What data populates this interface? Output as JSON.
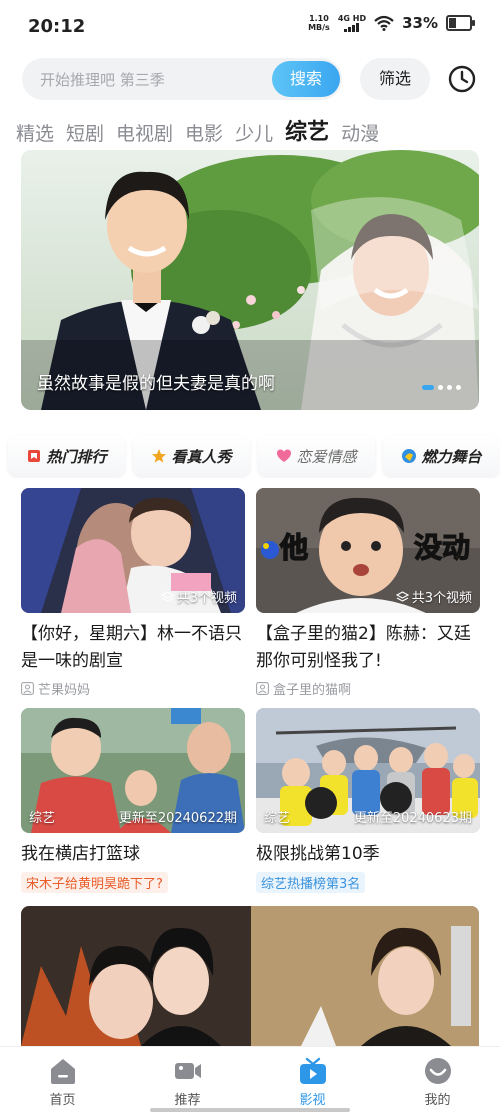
{
  "status_bar": {
    "time": "20:12",
    "speed_value": "1.10",
    "speed_unit": "MB/s",
    "network": "4G HD",
    "battery": "33%",
    "battery_level": 0.33
  },
  "search": {
    "placeholder": "开始推理吧 第三季",
    "button_label": "搜索",
    "filter_label": "筛选",
    "accent": "#3aa6f0"
  },
  "category_tabs": [
    "精选",
    "短剧",
    "电视剧",
    "电影",
    "少儿",
    "综艺",
    "动漫"
  ],
  "active_category": "综艺",
  "hero": {
    "caption": "虽然故事是假的但夫妻是真的啊",
    "slide_count": 4,
    "active_slide": 1
  },
  "chips": [
    {
      "label": "热门排行",
      "icon": "hot-rank-icon",
      "color": "#e8473a"
    },
    {
      "label": "看真人秀",
      "icon": "star-icon",
      "color": "#f2a51e"
    },
    {
      "label": "恋爱情感",
      "icon": "heart-icon",
      "color": "#f06a9a"
    },
    {
      "label": "燃力舞台",
      "icon": "stage-icon",
      "color": "#2f8fe0"
    }
  ],
  "cards": [
    {
      "title": "【你好，星期六】林一不语只是一味的剧宣",
      "count": "共3个视频",
      "author": "芒果妈妈"
    },
    {
      "title": "【盒子里的猫2】陈赫：又廷那你可别怪我了!",
      "count": "共3个视频",
      "author": "盒子里的猫啊",
      "overlay_left": "他",
      "overlay_right": "没动"
    },
    {
      "title": "我在横店打篮球",
      "tag": "综艺",
      "update": "更新至20240622期",
      "badge": "宋木子给黄明昊跪下了?"
    },
    {
      "title": "极限挑战第10季",
      "tag": "综艺",
      "update": "更新至20240623期",
      "badge": "综艺热播榜第3名"
    }
  ],
  "bottom_nav": [
    {
      "label": "首页",
      "icon": "home-icon"
    },
    {
      "label": "推荐",
      "icon": "video-camera-icon"
    },
    {
      "label": "影视",
      "icon": "tv-icon"
    },
    {
      "label": "我的",
      "icon": "profile-icon"
    }
  ],
  "active_nav": "影视",
  "nav_active_color": "#2f97e8"
}
